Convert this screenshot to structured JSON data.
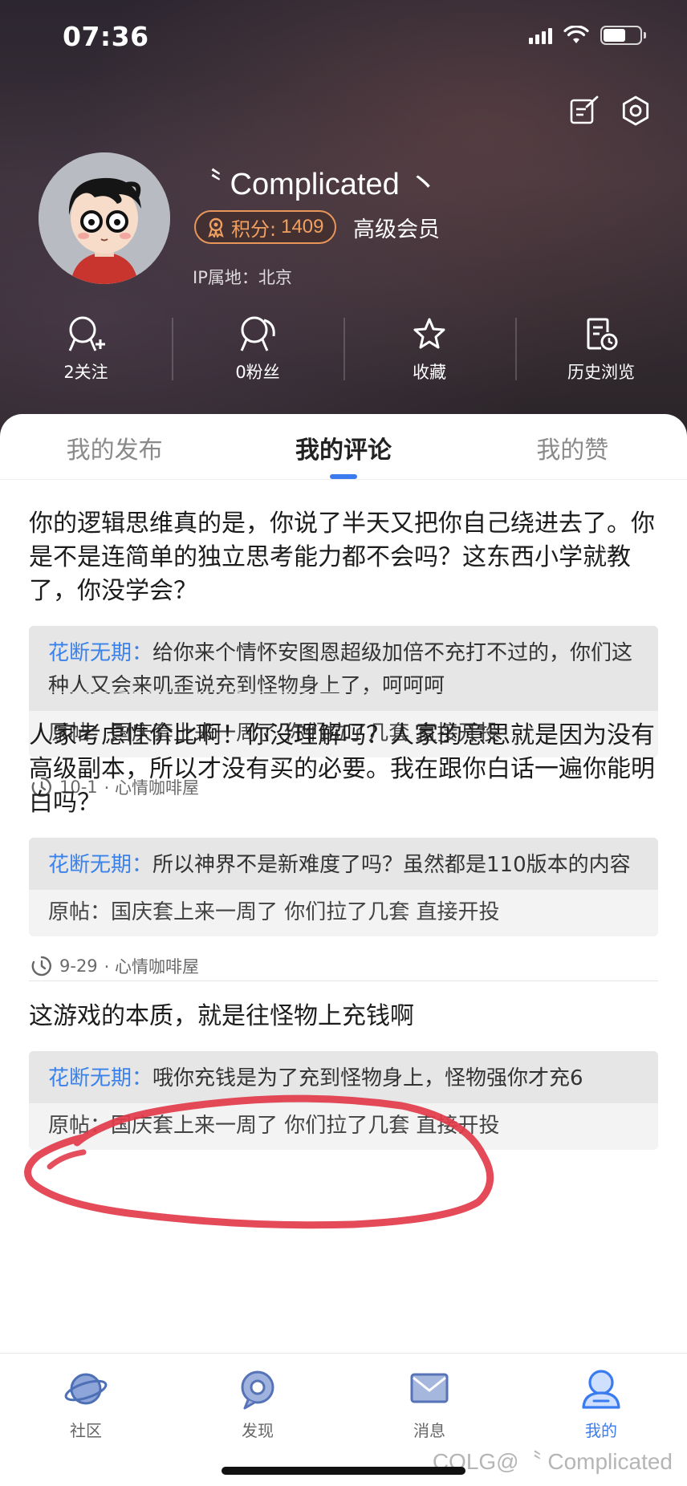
{
  "status_bar": {
    "time": "07:36"
  },
  "profile": {
    "username": "〝 Complicated 丶",
    "points_label": "积分:",
    "points_value": "1409",
    "member_level": "高级会员",
    "ip_location": "IP属地：北京"
  },
  "stats": [
    {
      "label": "2关注",
      "icon": "follow-icon"
    },
    {
      "label": "0粉丝",
      "icon": "fans-icon"
    },
    {
      "label": "收藏",
      "icon": "star-icon"
    },
    {
      "label": "历史浏览",
      "icon": "history-icon"
    }
  ],
  "tabs": [
    {
      "label": "我的发布",
      "active": false
    },
    {
      "label": "我的评论",
      "active": true
    },
    {
      "label": "我的赞",
      "active": false
    }
  ],
  "comments": [
    {
      "text": "你的逻辑思维真的是，你说了半天又把你自己绕进去了。你是不是连简单的独立思考能力都不会吗？这东西小学就教了，你没学会？",
      "reply_author": "花断无期：",
      "reply_text": "给你来个情怀安图恩超级加倍不充打不过的，你们这种人又会来叽歪说充到怪物身上了，呵呵呵",
      "post_title": "原帖：国庆套上来一周了 你们拉了几套  直接开投",
      "date": "10-1",
      "board": "· 心情咖啡屋"
    },
    {
      "text": "人家考虑性价比啊！你没理解吗？人家的意思就是因为没有高级副本，所以才没有买的必要。我在跟你白话一遍你能明白吗？",
      "reply_author": "花断无期：",
      "reply_text": "所以神界不是新难度了吗？虽然都是110版本的内容",
      "post_title": "原帖：国庆套上来一周了 你们拉了几套  直接开投",
      "date": "9-29",
      "board": "· 心情咖啡屋"
    },
    {
      "text": "这游戏的本质，就是往怪物上充钱啊",
      "reply_author": "花断无期：",
      "reply_text": "哦你充钱是为了充到怪物身上，怪物强你才充6",
      "post_title": "原帖：国庆套上来一周了 你们拉了几套  直接开投"
    }
  ],
  "bottom_nav": [
    {
      "label": "社区",
      "icon": "planet-icon",
      "active": false
    },
    {
      "label": "发现",
      "icon": "discover-icon",
      "active": false
    },
    {
      "label": "消息",
      "icon": "mail-icon",
      "active": false
    },
    {
      "label": "我的",
      "icon": "profile-icon",
      "active": true
    }
  ],
  "watermark": "COLG@〝 Complicated",
  "colors": {
    "accent": "#3a7cf0",
    "reply_author": "#3a82ea",
    "points": "#f0a060",
    "scribble": "#e23b4a"
  }
}
